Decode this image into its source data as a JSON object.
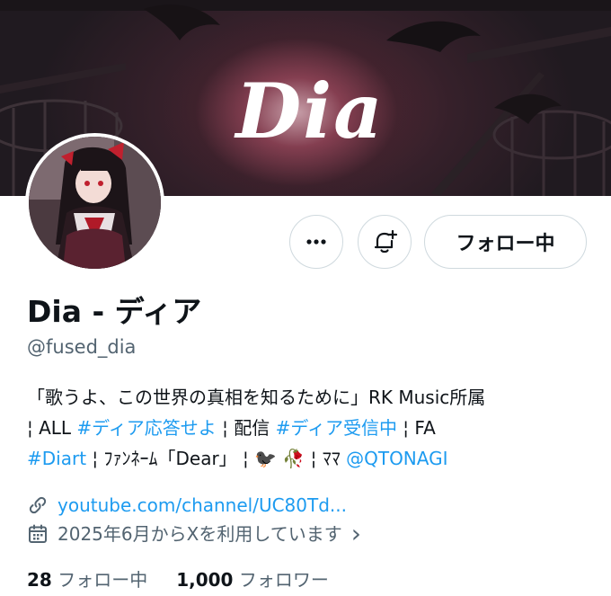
{
  "banner": {
    "logo_text": "Dia"
  },
  "profile": {
    "display_name": "Dia - ディア",
    "handle": "@fused_dia",
    "follow_button_label": "フォロー中"
  },
  "bio": {
    "line1": "「歌うよ、この世界の真相を知るために」RK Music所属",
    "line2_a": "¦ ALL ",
    "line2_tag1": "#ディア応答せよ",
    "line2_b": " ¦ 配信 ",
    "line2_tag2": "#ディア受信中",
    "line2_c": " ¦ FA",
    "line3_tag": "#Diart",
    "line3_a": " ¦ ﾌｧﾝﾈｰﾑ「Dear」 ¦ 🐦‍⬛ 🥀 ¦ ﾏﾏ ",
    "line3_mention": "@QTONAGI"
  },
  "meta": {
    "website": "youtube.com/channel/UC80Td...",
    "joined": "2025年6月からXを利用しています",
    "joined_chevron": "›"
  },
  "stats": {
    "following_count": "28",
    "following_label": "フォロー中",
    "followers_count": "1,000",
    "followers_label": "フォロワー"
  },
  "colors": {
    "accent": "#1d9bf0",
    "secondary_text": "#536471",
    "border": "#cfd9de"
  },
  "icons": [
    "more-icon",
    "notification-add-icon",
    "link-icon",
    "calendar-icon",
    "chevron-right-icon"
  ]
}
